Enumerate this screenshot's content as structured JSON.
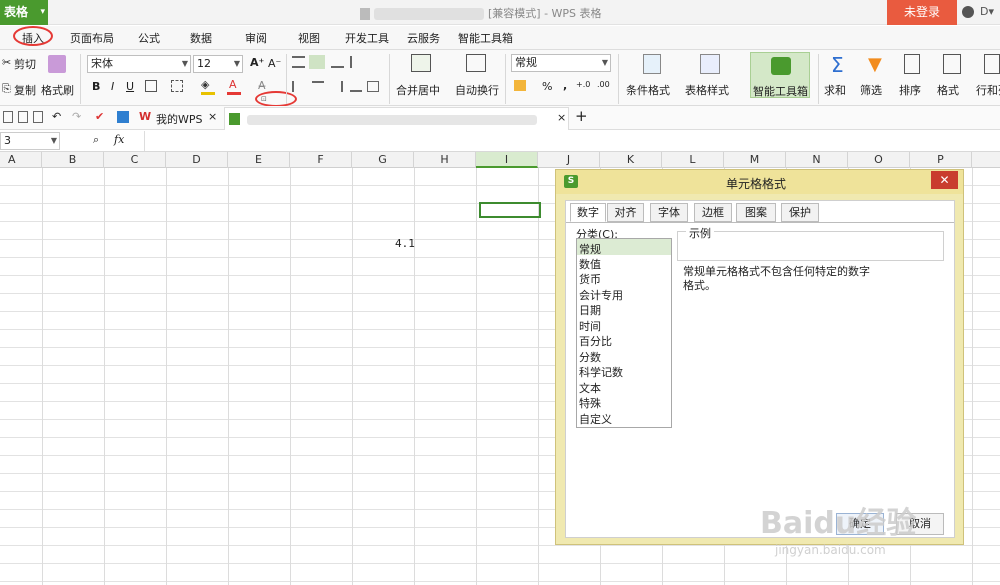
{
  "app": {
    "app_button": "表格",
    "window_title": "[兼容模式] - WPS 表格",
    "login": "未登录"
  },
  "menu": {
    "items": [
      "插入",
      "页面布局",
      "公式",
      "数据",
      "审阅",
      "视图",
      "开发工具",
      "云服务",
      "智能工具箱"
    ]
  },
  "ribbon": {
    "cut": "剪切",
    "copy": "复制",
    "format_painter": "格式刷",
    "font_name": "宋体",
    "font_size": "12",
    "bold": "B",
    "italic": "I",
    "underline": "U",
    "merge_center": "合并居中",
    "auto_wrap": "自动换行",
    "number_format": "常规",
    "percent": "%",
    "thousands": ",",
    "cond_format": "条件格式",
    "table_style": "表格样式",
    "smart_toolbox": "智能工具箱",
    "sum": "求和",
    "filter": "筛选",
    "sort": "排序",
    "format": "格式",
    "rows_cols": "行和列"
  },
  "tabs": {
    "my_wps": "我的WPS"
  },
  "formula": {
    "cell_ref": "3",
    "fx": "fx"
  },
  "columns": [
    "A",
    "B",
    "C",
    "D",
    "E",
    "F",
    "G",
    "H",
    "I",
    "J",
    "K",
    "L",
    "M",
    "N",
    "O",
    "P"
  ],
  "cell_value": "4.1",
  "dialog": {
    "title": "单元格格式",
    "tabs": [
      "数字",
      "对齐",
      "字体",
      "边框",
      "图案",
      "保护"
    ],
    "category_label": "分类(C):",
    "categories": [
      "常规",
      "数值",
      "货币",
      "会计专用",
      "日期",
      "时间",
      "百分比",
      "分数",
      "科学记数",
      "文本",
      "特殊",
      "自定义"
    ],
    "selected_category": "常规",
    "sample_label": "示例",
    "description": "常规单元格格式不包含任何特定的数字格式。",
    "ok": "确定",
    "cancel": "取消"
  },
  "watermark": {
    "text": "Baidu经验",
    "url": "jingyan.baidu.com"
  },
  "colors": {
    "accent_green": "#4a9a2e",
    "login_red": "#e95b3f",
    "dialog_frame": "#f0e9b0",
    "annotation_red": "#e53935"
  }
}
